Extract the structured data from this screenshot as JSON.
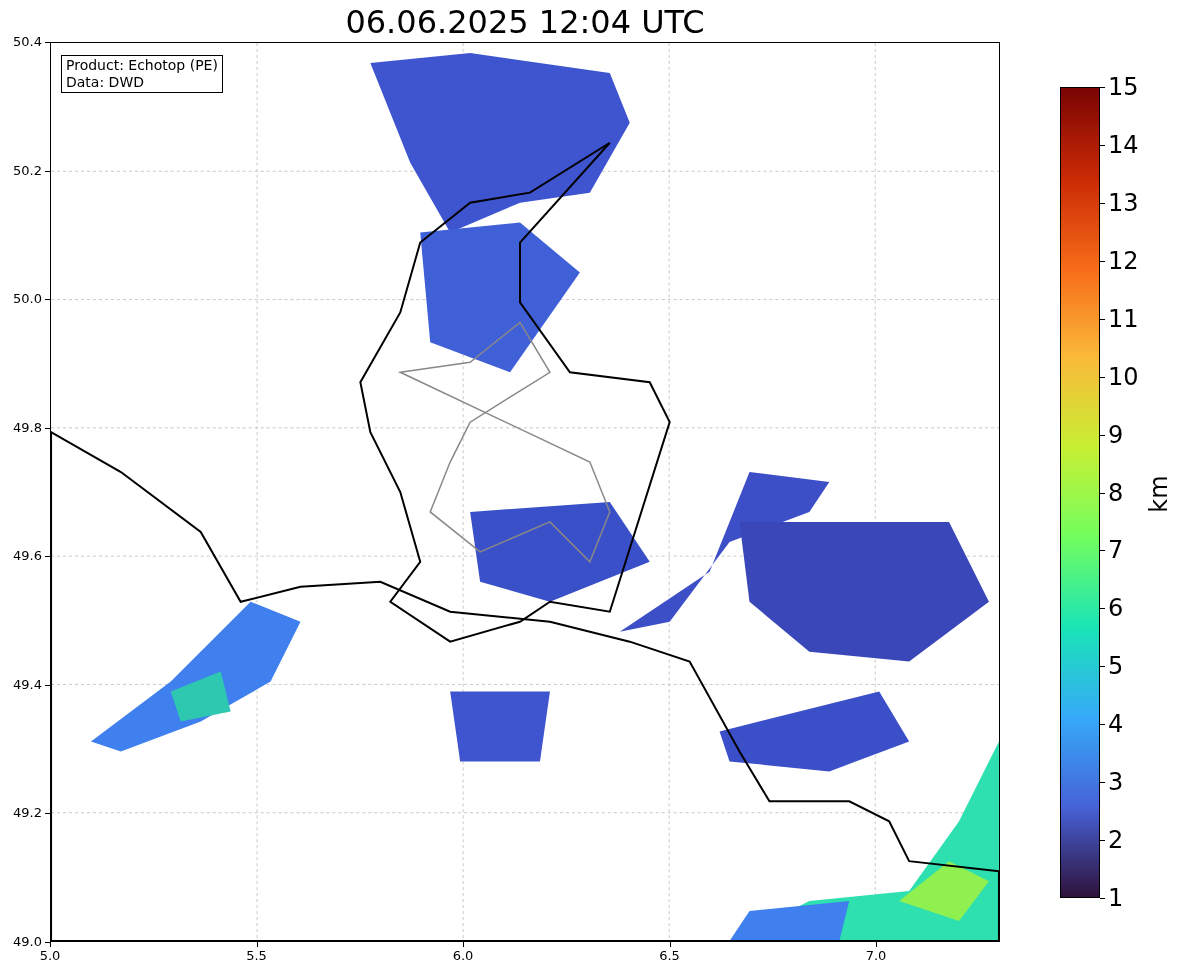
{
  "title": "06.06.2025 12:04 UTC",
  "info_box": [
    "Product: Echotop (PE)",
    "Data: DWD"
  ],
  "x_axis": {
    "ticks": [
      "5.0",
      "5.5",
      "6.0",
      "6.5",
      "7.0"
    ]
  },
  "y_axis": {
    "ticks": [
      "50.4",
      "50.2",
      "50.0",
      "49.8",
      "49.6",
      "49.4",
      "49.2",
      "49.0"
    ]
  },
  "colorbar": {
    "label": "km",
    "ticks": [
      "15",
      "14",
      "13",
      "12",
      "11",
      "10",
      "9",
      "8",
      "7",
      "6",
      "5",
      "4",
      "3",
      "2",
      "1"
    ]
  }
}
